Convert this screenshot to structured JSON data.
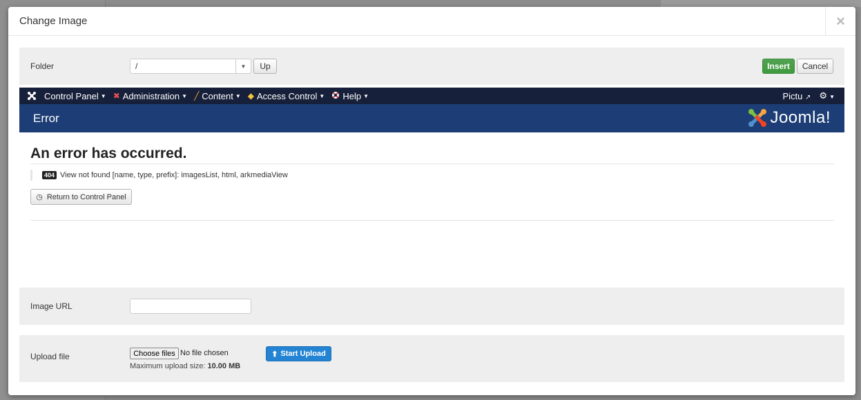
{
  "modal": {
    "title": "Change Image",
    "close_icon": "×"
  },
  "folder": {
    "label": "Folder",
    "value": "/",
    "up_label": "Up",
    "insert_label": "Insert",
    "cancel_label": "Cancel"
  },
  "joomla_nav": {
    "items": [
      {
        "label": "Control Panel",
        "icon": "joomla-icon"
      },
      {
        "label": "Administration",
        "icon": "tools-icon"
      },
      {
        "label": "Content",
        "icon": "pencil-icon"
      },
      {
        "label": "Access Control",
        "icon": "key-icon"
      },
      {
        "label": "Help",
        "icon": "lifebuoy-icon"
      }
    ],
    "user_label": "Pictu",
    "header_title": "Error",
    "brand": "Joomla!"
  },
  "error": {
    "title": "An error has occurred.",
    "code": "404",
    "message": "View not found [name, type, prefix]: imagesList, html, arkmediaView",
    "return_label": "Return to Control Panel"
  },
  "image_url": {
    "label": "Image URL",
    "value": ""
  },
  "upload": {
    "label": "Upload file",
    "choose_label": "Choose files",
    "no_file": "No file chosen",
    "max_size_prefix": "Maximum upload size:",
    "max_size_value": "10.00 MB",
    "start_label": "Start Upload"
  },
  "colors": {
    "insert": "#46a046",
    "upload": "#2384d3",
    "nav_dark": "#17203a",
    "header_blue": "#1c3d75"
  }
}
